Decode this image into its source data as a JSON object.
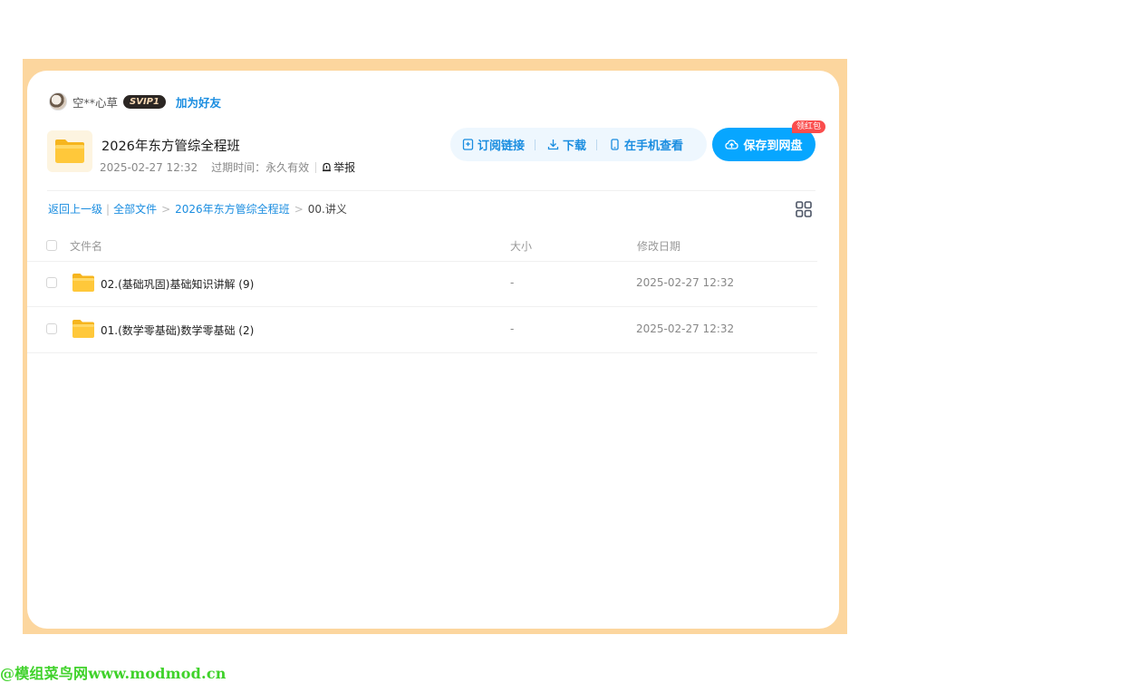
{
  "user": {
    "name": "空**心草",
    "badge": "SVIP1",
    "add_friend": "加为好友"
  },
  "share": {
    "title": "2026年东方管综全程班",
    "date": "2025-02-27 12:32",
    "expiry": "过期时间：永久有效",
    "report": "举报"
  },
  "actions": {
    "subscribe": "订阅链接",
    "download": "下载",
    "phone": "在手机查看",
    "save": "保存到网盘",
    "red_packet": "领红包"
  },
  "breadcrumb": {
    "back": "返回上一级",
    "all": "全部文件",
    "folder": "2026年东方管综全程班",
    "current": "00.讲义"
  },
  "table": {
    "headers": {
      "name": "文件名",
      "size": "大小",
      "date": "修改日期"
    },
    "rows": [
      {
        "name": "02.(基础巩固)基础知识讲解 (9)",
        "size": "-",
        "date": "2025-02-27 12:32"
      },
      {
        "name": "01.(数学零基础)数学零基础 (2)",
        "size": "-",
        "date": "2025-02-27 12:32"
      }
    ]
  },
  "watermark": "@模组菜鸟网www.modmod.cn",
  "colors": {
    "accent": "#07a6ff",
    "link": "#1a8de0",
    "frame": "#fcd69e",
    "folder": "#ffc83a"
  }
}
